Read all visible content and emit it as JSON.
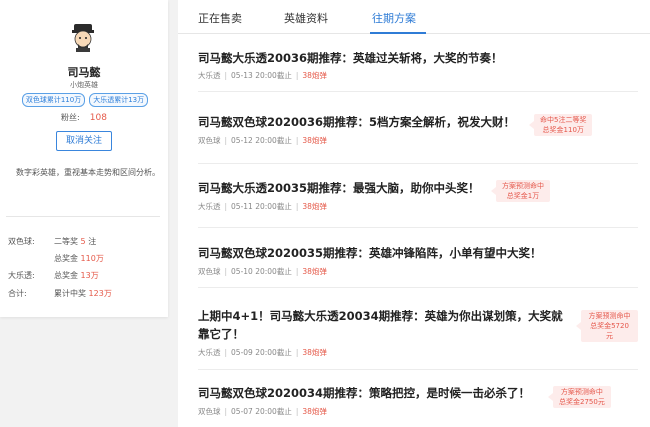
{
  "profile": {
    "name": "司马懿",
    "title": "小炮英雄",
    "tags": [
      "双色球累计110万",
      "大乐透累计13万"
    ],
    "fans_label": "粉丝:",
    "fans_count": "108",
    "follow_button": "取消关注",
    "description": "数字彩英雄，重视基本走势和区间分析。",
    "stats": {
      "ssq_label": "双色球:",
      "ssq_second_label": "二等奖",
      "ssq_second_value": "5",
      "ssq_second_unit": "注",
      "ssq_total_label": "总奖金",
      "ssq_total_value": "110万",
      "dlt_label": "大乐透:",
      "dlt_total_label": "总奖金",
      "dlt_total_value": "13万",
      "sum_label": "合计:",
      "sum_total_label": "累计中奖",
      "sum_total_value": "123万"
    }
  },
  "tabs": [
    "正在售卖",
    "英雄资料",
    "往期方案"
  ],
  "active_tab": "往期方案",
  "articles": [
    {
      "title": "司马懿大乐透20036期推荐：英雄过关斩将，大奖的节奏！",
      "lottery": "大乐透",
      "time": "05-13 20:00截止",
      "price": "38炮弹",
      "badge": []
    },
    {
      "title": "司马懿双色球2020036期推荐：5档方案全解析，祝发大财！",
      "lottery": "双色球",
      "time": "05-12 20:00截止",
      "price": "38炮弹",
      "badge": [
        "命中5注二等奖",
        "总奖金110万"
      ]
    },
    {
      "title": "司马懿大乐透20035期推荐：最强大脑，助你中头奖！",
      "lottery": "大乐透",
      "time": "05-11 20:00截止",
      "price": "38炮弹",
      "badge": [
        "方案预测命中",
        "总奖金1万"
      ]
    },
    {
      "title": "司马懿双色球2020035期推荐：英雄冲锋陷阵，小单有望中大奖！",
      "lottery": "双色球",
      "time": "05-10 20:00截止",
      "price": "38炮弹",
      "badge": []
    },
    {
      "title": "上期中4+1！司马懿大乐透20034期推荐：英雄为你出谋划策，大奖就靠它了！",
      "lottery": "大乐透",
      "time": "05-09 20:00截止",
      "price": "38炮弹",
      "badge": [
        "方案预测命中",
        "总奖金5720元"
      ]
    },
    {
      "title": "司马懿双色球2020034期推荐：策略把控，是时候一击必杀了！",
      "lottery": "双色球",
      "time": "05-07 20:00截止",
      "price": "38炮弹",
      "badge": [
        "方案预测命中",
        "总奖金2750元"
      ]
    }
  ],
  "icons": {
    "avatar": "cartoon-general-avatar"
  },
  "colors": {
    "accent_blue": "#2f7cd6",
    "accent_red": "#e55a4a",
    "badge_bg": "#fdeceb"
  }
}
